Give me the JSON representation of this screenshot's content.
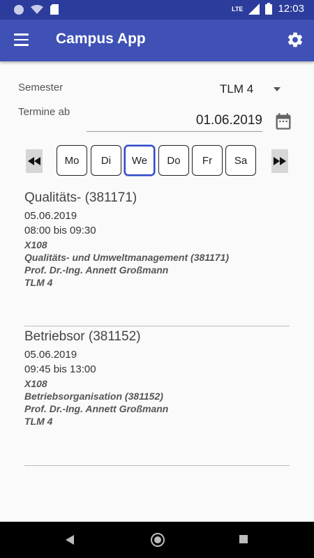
{
  "statusbar": {
    "time": "12:03",
    "network": "LTE"
  },
  "appbar": {
    "title": "Campus App"
  },
  "filters": {
    "semester_label": "Semester",
    "semester_value": "TLM 4",
    "date_label": "Termine ab",
    "date_value": "01.06.2019"
  },
  "days": [
    "Mo",
    "Di",
    "We",
    "Do",
    "Fr",
    "Sa"
  ],
  "events": [
    {
      "title": "Qualitäts- (381171)",
      "date": "05.06.2019",
      "time": "08:00 bis 09:30",
      "room": "X108",
      "course": "Qualitäts- und Umweltmanagement (381171)",
      "lecturer": "Prof. Dr.-Ing. Annett Großmann",
      "group": "TLM 4"
    },
    {
      "title": "Betriebsor (381152)",
      "date": "05.06.2019",
      "time": "09:45 bis 13:00",
      "room": "X108",
      "course": "Betriebsorganisation (381152)",
      "lecturer": "Prof. Dr.-Ing. Annett Großmann",
      "group": "TLM 4"
    }
  ],
  "colors": {
    "appbar": "#3f51b5",
    "statusbar": "#2c3c9c",
    "selected_day": "#2d47c4"
  }
}
